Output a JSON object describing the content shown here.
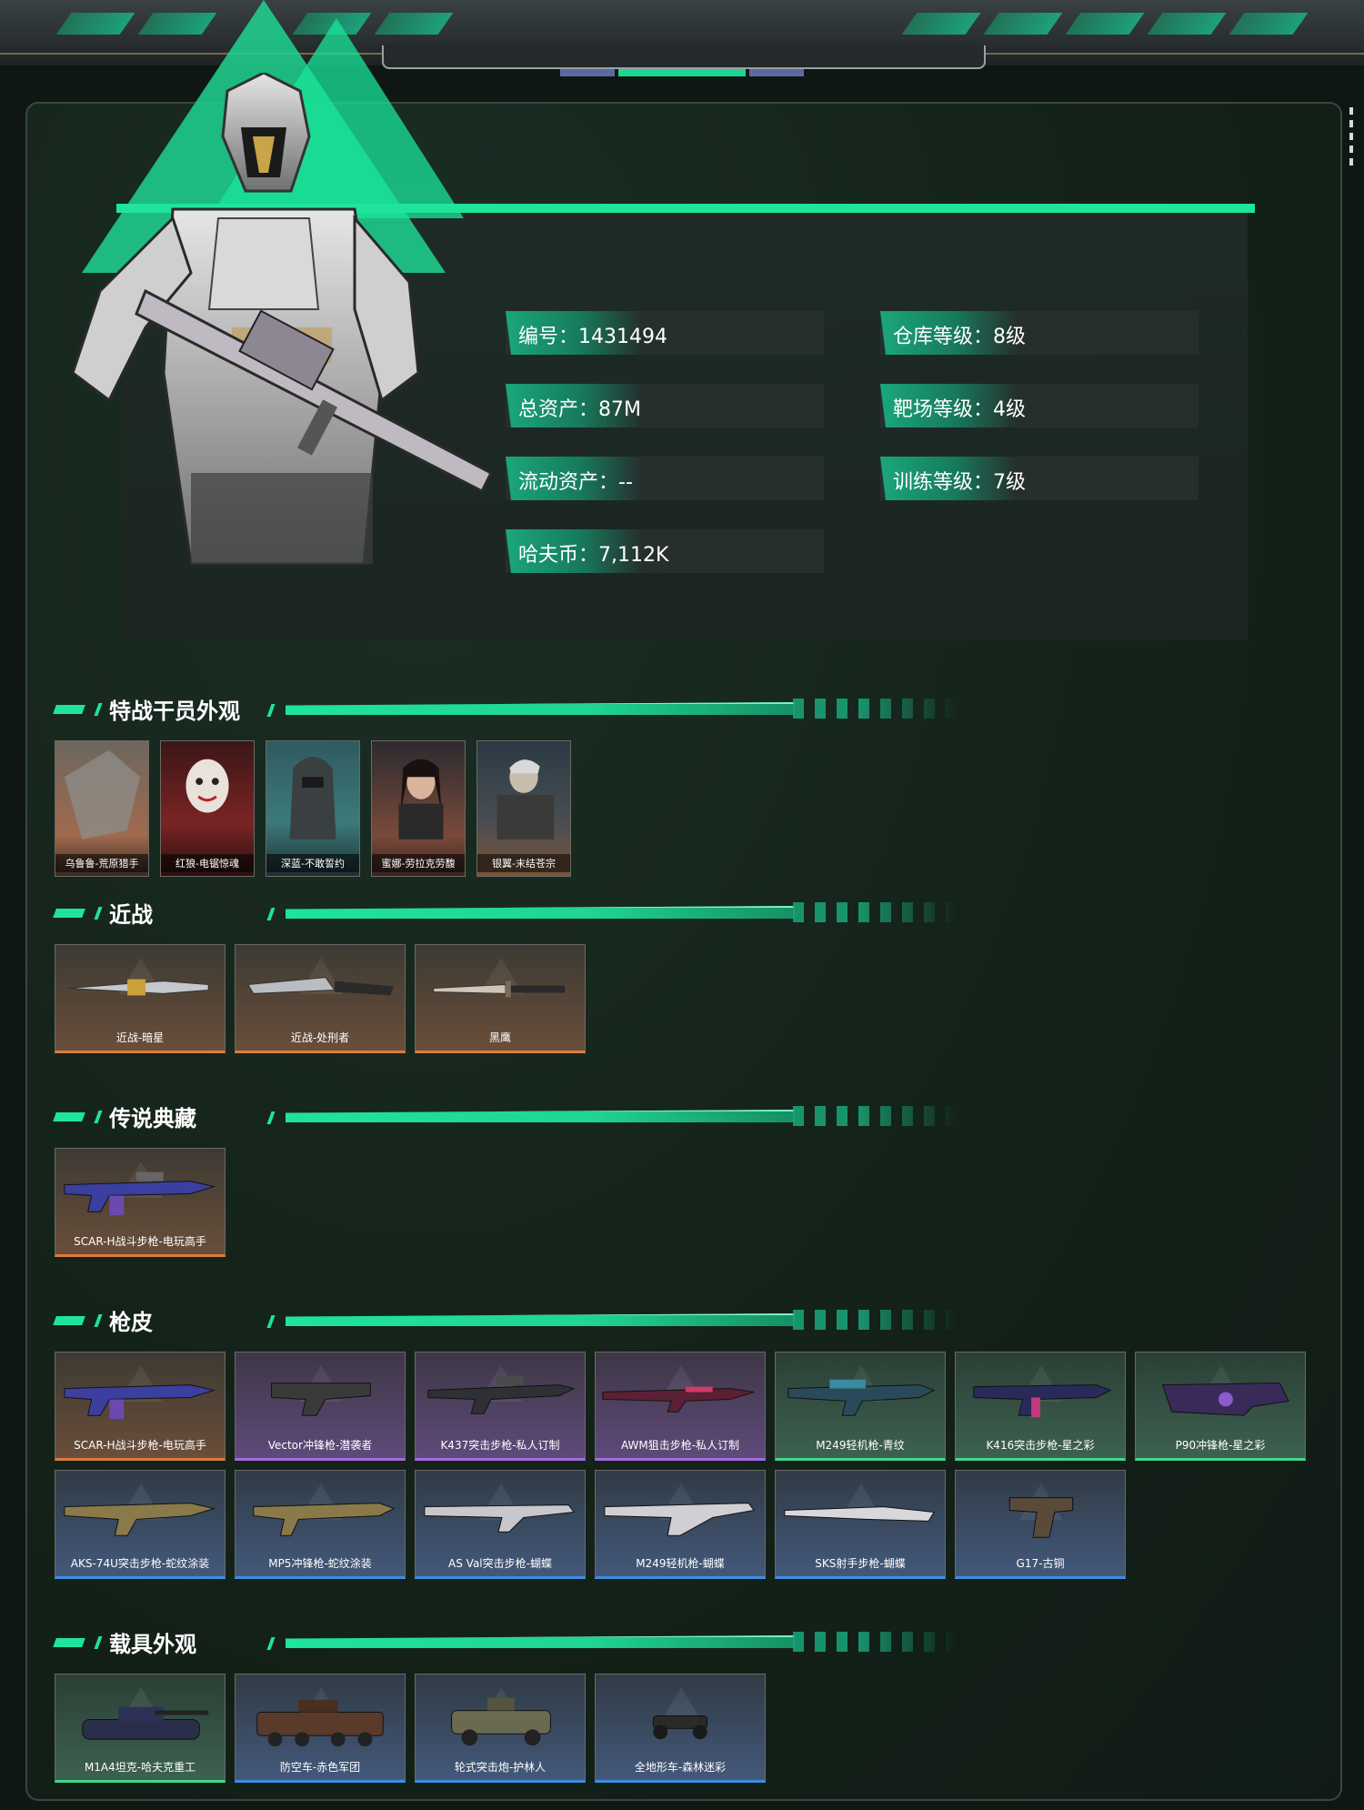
{
  "player": {
    "stats": [
      {
        "label": "编号",
        "value": "1431494"
      },
      {
        "label": "仓库等级",
        "value": "8级"
      },
      {
        "label": "总资产",
        "value": "87M"
      },
      {
        "label": "靶场等级",
        "value": "4级"
      },
      {
        "label": "流动资产",
        "value": "--"
      },
      {
        "label": "训练等级",
        "value": "7级"
      },
      {
        "label": "哈夫币",
        "value": "7,112K"
      }
    ]
  },
  "sections": {
    "operators": {
      "title": "特战干员外观",
      "items": [
        "乌鲁鲁-荒原猎手",
        "红狼-电锯惊魂",
        "深蓝-不敢誓约",
        "蜜娜-劳拉克劳馥",
        "银翼-末结苍宗"
      ]
    },
    "melee": {
      "title": "近战",
      "items": [
        "近战-暗星",
        "近战-处刑者",
        "黑鹰"
      ]
    },
    "legend": {
      "title": "传说典藏",
      "items": [
        "SCAR-H战斗步枪-电玩高手"
      ]
    },
    "skins": {
      "title": "枪皮",
      "items": [
        {
          "name": "SCAR-H战斗步枪-电玩高手",
          "rarity": "orange"
        },
        {
          "name": "Vector冲锋枪-潜袭者",
          "rarity": "purple"
        },
        {
          "name": "K437突击步枪-私人订制",
          "rarity": "purple"
        },
        {
          "name": "AWM狙击步枪-私人订制",
          "rarity": "purple"
        },
        {
          "name": "M249轻机枪-青纹",
          "rarity": "green"
        },
        {
          "name": "K416突击步枪-星之彩",
          "rarity": "green"
        },
        {
          "name": "P90冲锋枪-星之彩",
          "rarity": "green"
        },
        {
          "name": "AKS-74U突击步枪-蛇纹涂装",
          "rarity": "blue"
        },
        {
          "name": "MP5冲锋枪-蛇纹涂装",
          "rarity": "blue"
        },
        {
          "name": "AS Val突击步枪-蝴蝶",
          "rarity": "blue"
        },
        {
          "name": "M249轻机枪-蝴蝶",
          "rarity": "blue"
        },
        {
          "name": "SKS射手步枪-蝴蝶",
          "rarity": "blue"
        },
        {
          "name": "G17-古铜",
          "rarity": "blue"
        }
      ]
    },
    "vehicles": {
      "title": "载具外观",
      "items": [
        {
          "name": "M1A4坦克-哈夫克重工",
          "rarity": "green"
        },
        {
          "name": "防空车-赤色军团",
          "rarity": "blue"
        },
        {
          "name": "轮式突击炮-护林人",
          "rarity": "blue"
        },
        {
          "name": "全地形车-森林迷彩",
          "rarity": "blue"
        }
      ]
    }
  },
  "colors": {
    "accent": "#1fe49b",
    "orange": "#e07a3a",
    "purple": "#a36be0",
    "green": "#3fd88a",
    "blue": "#3d8de0"
  }
}
